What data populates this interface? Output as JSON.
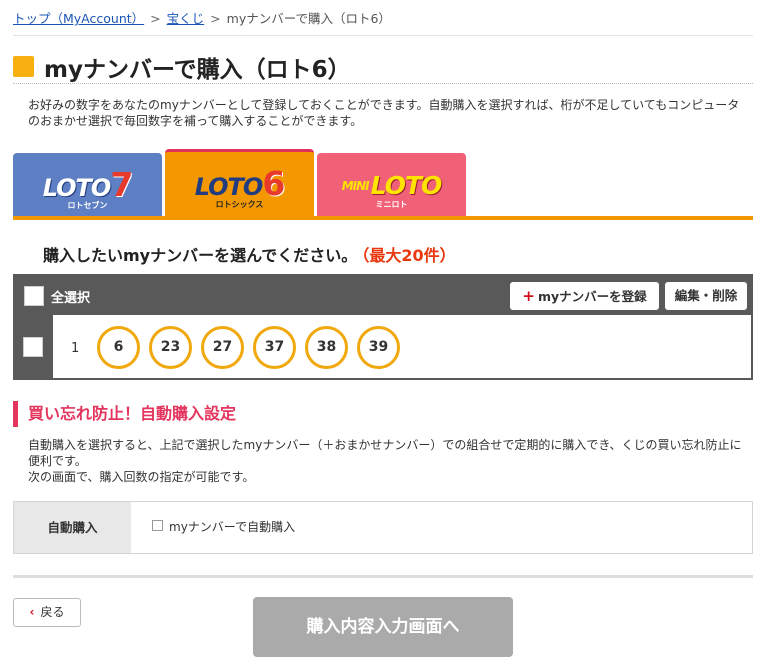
{
  "breadcrumb": {
    "home": "トップ（MyAccount）",
    "takarakuji": "宝くじ",
    "current": "myナンバーで購入（ロト6）",
    "separator": ">"
  },
  "page": {
    "title": "myナンバーで購入（ロト6）",
    "intro": "お好みの数字をあなたのmyナンバーとして登録しておくことができます。自動購入を選択すれば、桁が不足していてもコンピュータのおまかせ選択で毎回数字を補って購入することができます。"
  },
  "tabs": [
    {
      "logo": "LOTO",
      "num": "7",
      "sub": "ロトセブン",
      "active": false
    },
    {
      "logo": "LOTO",
      "num": "6",
      "sub": "ロトシックス",
      "active": true
    },
    {
      "mini": "MINI",
      "logo": "LOTO",
      "sub": "ミニロト",
      "active": false
    }
  ],
  "selection": {
    "heading": "購入したいmyナンバーを選んでください。",
    "max": "（最大20件）",
    "select_all": "全選択",
    "register_button": "myナンバーを登録",
    "register_icon": "+",
    "edit_button": "編集・削除",
    "rows": [
      {
        "no": "1",
        "numbers": [
          "6",
          "23",
          "27",
          "37",
          "38",
          "39"
        ]
      }
    ]
  },
  "auto_purchase": {
    "heading": "買い忘れ防止！自動購入設定",
    "desc_line1": "自動購入を選択すると、上記で選択したmyナンバー（＋おまかせナンバー）での組合せで定期的に購入でき、くじの買い忘れ防止に便利です。",
    "desc_line2": "次の画面で、購入回数の指定が可能です。",
    "label": "自動購入",
    "checkbox_label": "myナンバーで自動購入"
  },
  "footer": {
    "back": "戻る",
    "back_icon": "‹",
    "next": "購入内容入力画面へ"
  },
  "colors": {
    "accent_orange": "#f39800",
    "loto7_blue": "#5e7fc3",
    "miniloto_pink": "#f06178",
    "ball_ring": "#f1a80c",
    "alert_red": "#e3355d",
    "header_gray": "#595959"
  }
}
